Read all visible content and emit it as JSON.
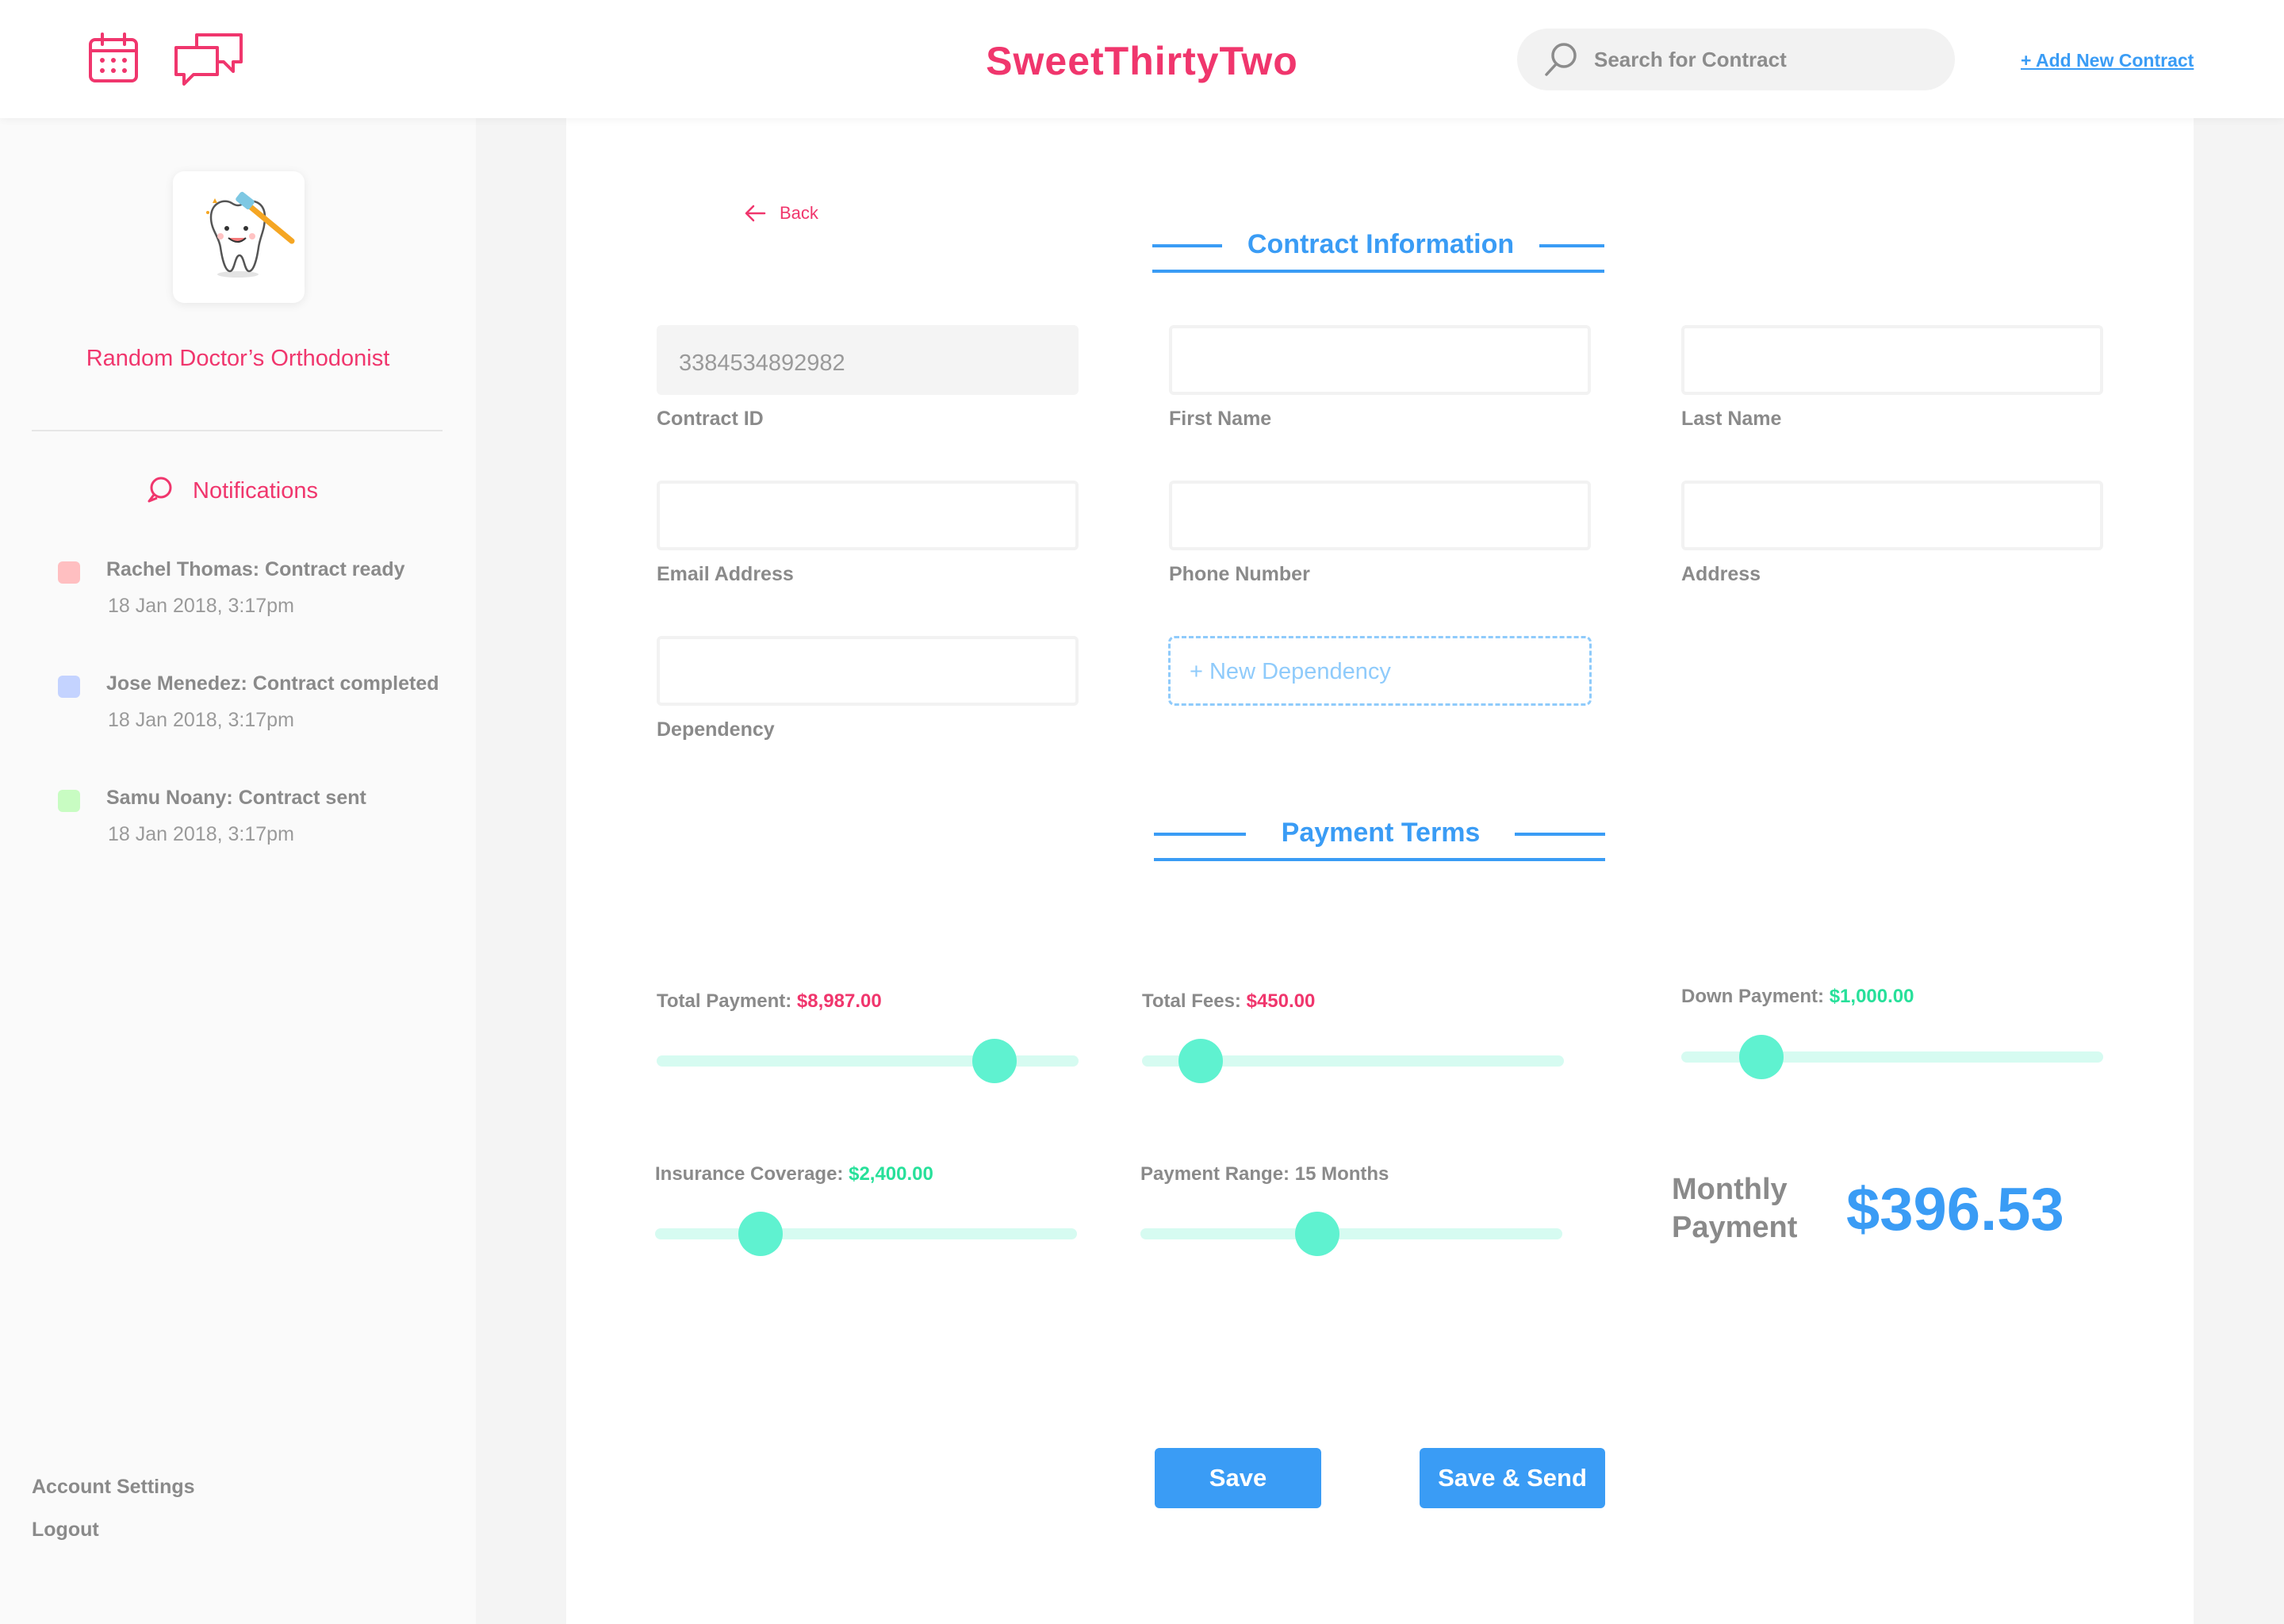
{
  "header": {
    "brand": "SweetThirtyTwo",
    "search_placeholder": "Search for Contract",
    "add_link": "+ Add New Contract"
  },
  "sidebar": {
    "clinic_name": "Random Doctor’s Orthodonist",
    "notifications_title": "Notifications",
    "notifications": [
      {
        "title": "Rachel Thomas: Contract ready",
        "time": "18 Jan 2018, 3:17pm",
        "color": "#ffbfc1"
      },
      {
        "title": "Jose Menedez: Contract completed",
        "time": "18 Jan 2018, 3:17pm",
        "color": "#c4d3ff"
      },
      {
        "title": "Samu Noany: Contract sent",
        "time": "18 Jan 2018, 3:17pm",
        "color": "#c8fcc2"
      }
    ],
    "links": [
      "Account Settings",
      "Logout"
    ]
  },
  "main": {
    "back_label": "Back",
    "contract_section_title": "Contract Information",
    "fields": {
      "contract_id": {
        "label": "Contract ID",
        "value": "3384534892982"
      },
      "first_name": {
        "label": "First Name",
        "value": ""
      },
      "last_name": {
        "label": "Last Name",
        "value": ""
      },
      "email": {
        "label": "Email Address",
        "value": ""
      },
      "phone": {
        "label": "Phone Number",
        "value": ""
      },
      "address": {
        "label": "Address",
        "value": ""
      },
      "dependency": {
        "label": "Dependency",
        "value": ""
      }
    },
    "new_dependency": "+ New Dependency",
    "payment_section_title": "Payment Terms",
    "sliders": {
      "total_payment": {
        "label": "Total Payment:",
        "amount": "$8,987.00",
        "level": 0.8
      },
      "total_fees": {
        "label": "Total Fees:",
        "amount": "$450.00",
        "level": 0.14
      },
      "down_payment": {
        "label": "Down Payment:",
        "amount": "$1,000.00",
        "level": 0.19
      },
      "insurance": {
        "label": "Insurance Coverage:",
        "amount": "$2,400.00",
        "level": 0.25
      },
      "payment_range": {
        "label": "Payment Range: 15 Months",
        "amount": "",
        "level": 0.42
      }
    },
    "monthly_label": "Monthly Payment",
    "monthly_value": "$396.53",
    "buttons": {
      "save": "Save",
      "save_send": "Save & Send"
    }
  },
  "colors": {
    "brand_pink": "#f0366d",
    "accent_blue": "#3a9cf5",
    "amount_green": "#27e09a",
    "slider_knob": "#5ff2d0",
    "slider_track": "#d6fbf1"
  },
  "icons": [
    "calendar-icon",
    "chat-icon",
    "search-icon",
    "tooth-logo",
    "notification-bubble-icon",
    "back-arrow-icon"
  ]
}
